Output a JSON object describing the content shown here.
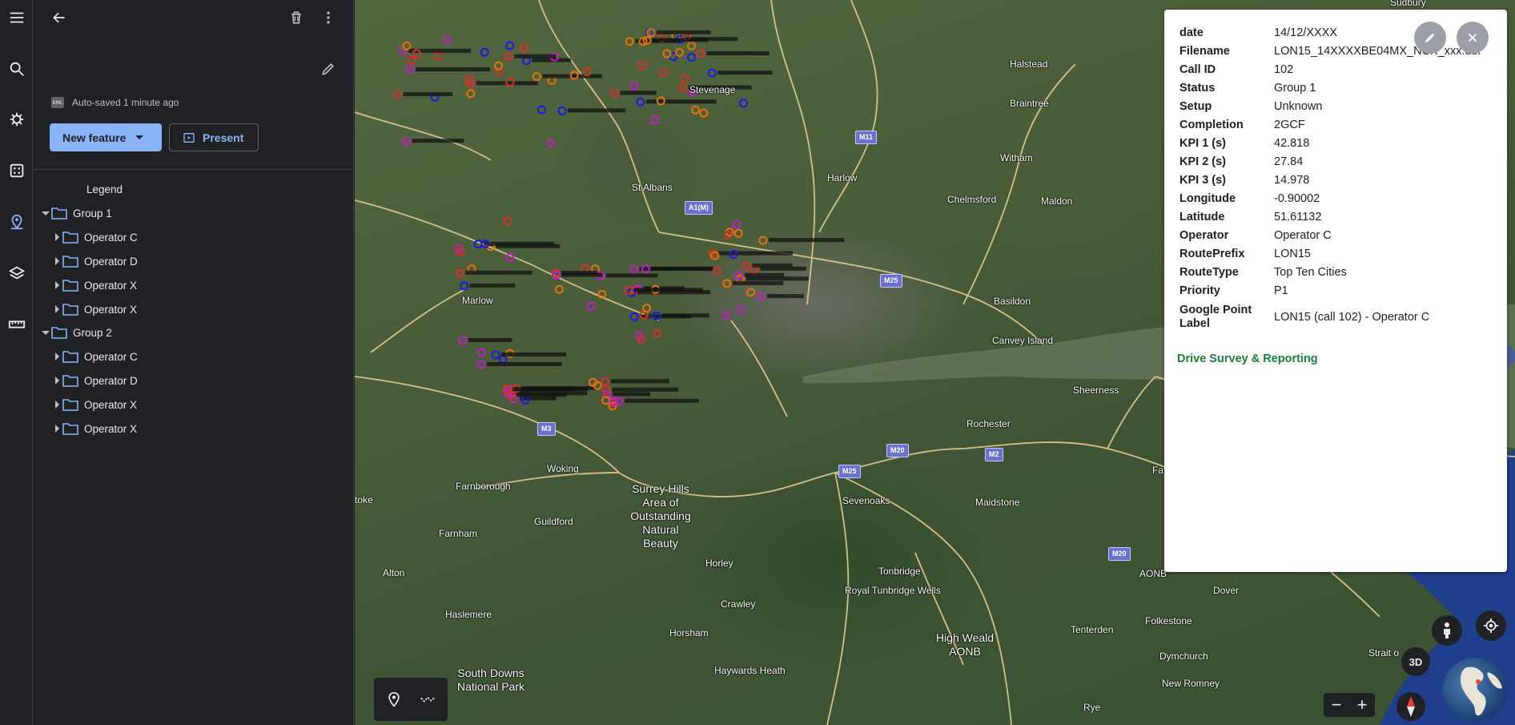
{
  "rail": {
    "items": [
      "menu",
      "search",
      "voyager",
      "feeling-lucky",
      "projects",
      "map-style",
      "measure"
    ]
  },
  "panel": {
    "autosave_text": "Auto-saved 1 minute ago",
    "kml_badge": "KML",
    "new_feature_label": "New feature",
    "present_label": "Present",
    "legend_label": "Legend",
    "tree": [
      {
        "label": "Group 1",
        "level": 0,
        "expanded": true
      },
      {
        "label": "Operator C",
        "level": 1,
        "expanded": false
      },
      {
        "label": "Operator D",
        "level": 1,
        "expanded": false
      },
      {
        "label": "Operator X",
        "level": 1,
        "expanded": false
      },
      {
        "label": "Operator X",
        "level": 1,
        "expanded": false
      },
      {
        "label": "Group 2",
        "level": 0,
        "expanded": true
      },
      {
        "label": "Operator C",
        "level": 1,
        "expanded": false
      },
      {
        "label": "Operator D",
        "level": 1,
        "expanded": false
      },
      {
        "label": "Operator X",
        "level": 1,
        "expanded": false
      },
      {
        "label": "Operator X",
        "level": 1,
        "expanded": false
      }
    ]
  },
  "map": {
    "places": [
      {
        "name": "Sudbury"
      },
      {
        "name": "Stevenage"
      },
      {
        "name": "Halstead"
      },
      {
        "name": "Braintree"
      },
      {
        "name": "St Albans"
      },
      {
        "name": "Harlow"
      },
      {
        "name": "Witham"
      },
      {
        "name": "Chelmsford"
      },
      {
        "name": "Maldon"
      },
      {
        "name": "Marlow"
      },
      {
        "name": "Basildon"
      },
      {
        "name": "Canvey Island"
      },
      {
        "name": "Sheerness"
      },
      {
        "name": "Rochester"
      },
      {
        "name": "Woking"
      },
      {
        "name": "Farnborough"
      },
      {
        "name": "Guildford"
      },
      {
        "name": "Sevenoaks"
      },
      {
        "name": "Maidstone"
      },
      {
        "name": "Faversha"
      },
      {
        "name": "Farnham"
      },
      {
        "name": "Alton"
      },
      {
        "name": "Horley"
      },
      {
        "name": "Tonbridge"
      },
      {
        "name": "Royal Tunbridge Wells"
      },
      {
        "name": "Crawley"
      },
      {
        "name": "Haslemere"
      },
      {
        "name": "Horsham"
      },
      {
        "name": "Tenterden"
      },
      {
        "name": "Folkestone"
      },
      {
        "name": "Dover"
      },
      {
        "name": "Dymchurch"
      },
      {
        "name": "New Romney"
      },
      {
        "name": "Haywards Heath"
      },
      {
        "name": "Rye"
      },
      {
        "name": "toke"
      },
      {
        "name": "AONB"
      },
      {
        "name": "Strait o"
      }
    ],
    "big_labels": [
      {
        "name": "Surrey Hills Area of Outstanding Natural Beauty"
      },
      {
        "name": "High Weald AONB"
      },
      {
        "name": "South Downs National Park"
      }
    ],
    "shields": [
      "M11",
      "A1(M)",
      "M25",
      "M3",
      "M20",
      "M2",
      "M25",
      "M20"
    ],
    "marker_colors": {
      "orange": "#e8710a",
      "red": "#d93025",
      "magenta": "#c51bc5",
      "blue": "#1a1ae0"
    }
  },
  "card": {
    "rows": [
      {
        "key": "date",
        "value": "14/12/XXXX"
      },
      {
        "key": "Filename",
        "value": "LON15_14XXXXBE04MX_NCX_xxx.dtx"
      },
      {
        "key": "Call ID",
        "value": "102"
      },
      {
        "key": "Status",
        "value": "Group 1"
      },
      {
        "key": "Setup",
        "value": "Unknown"
      },
      {
        "key": "Completion",
        "value": "2GCF"
      },
      {
        "key": "KPI 1 (s)",
        "value": "42.818"
      },
      {
        "key": "KPI 2 (s)",
        "value": "27.84"
      },
      {
        "key": "KPI 3 (s)",
        "value": "14.978"
      },
      {
        "key": "Longitude",
        "value": "-0.90002"
      },
      {
        "key": "Latitude",
        "value": "51.61132"
      },
      {
        "key": "Operator",
        "value": "Operator C"
      },
      {
        "key": "RoutePrefix",
        "value": "LON15"
      },
      {
        "key": "RouteType",
        "value": "Top Ten Cities"
      },
      {
        "key": "Priority",
        "value": "P1"
      }
    ],
    "label_key_line1": "Google Point",
    "label_key_line2": "Label",
    "label_value": "LON15 (call 102) - Operator C",
    "link_text": "Drive Survey & Reporting",
    "link_color": "#188038"
  },
  "controls": {
    "three_d_label": "3D",
    "zoom_out": "−",
    "zoom_in": "+"
  }
}
